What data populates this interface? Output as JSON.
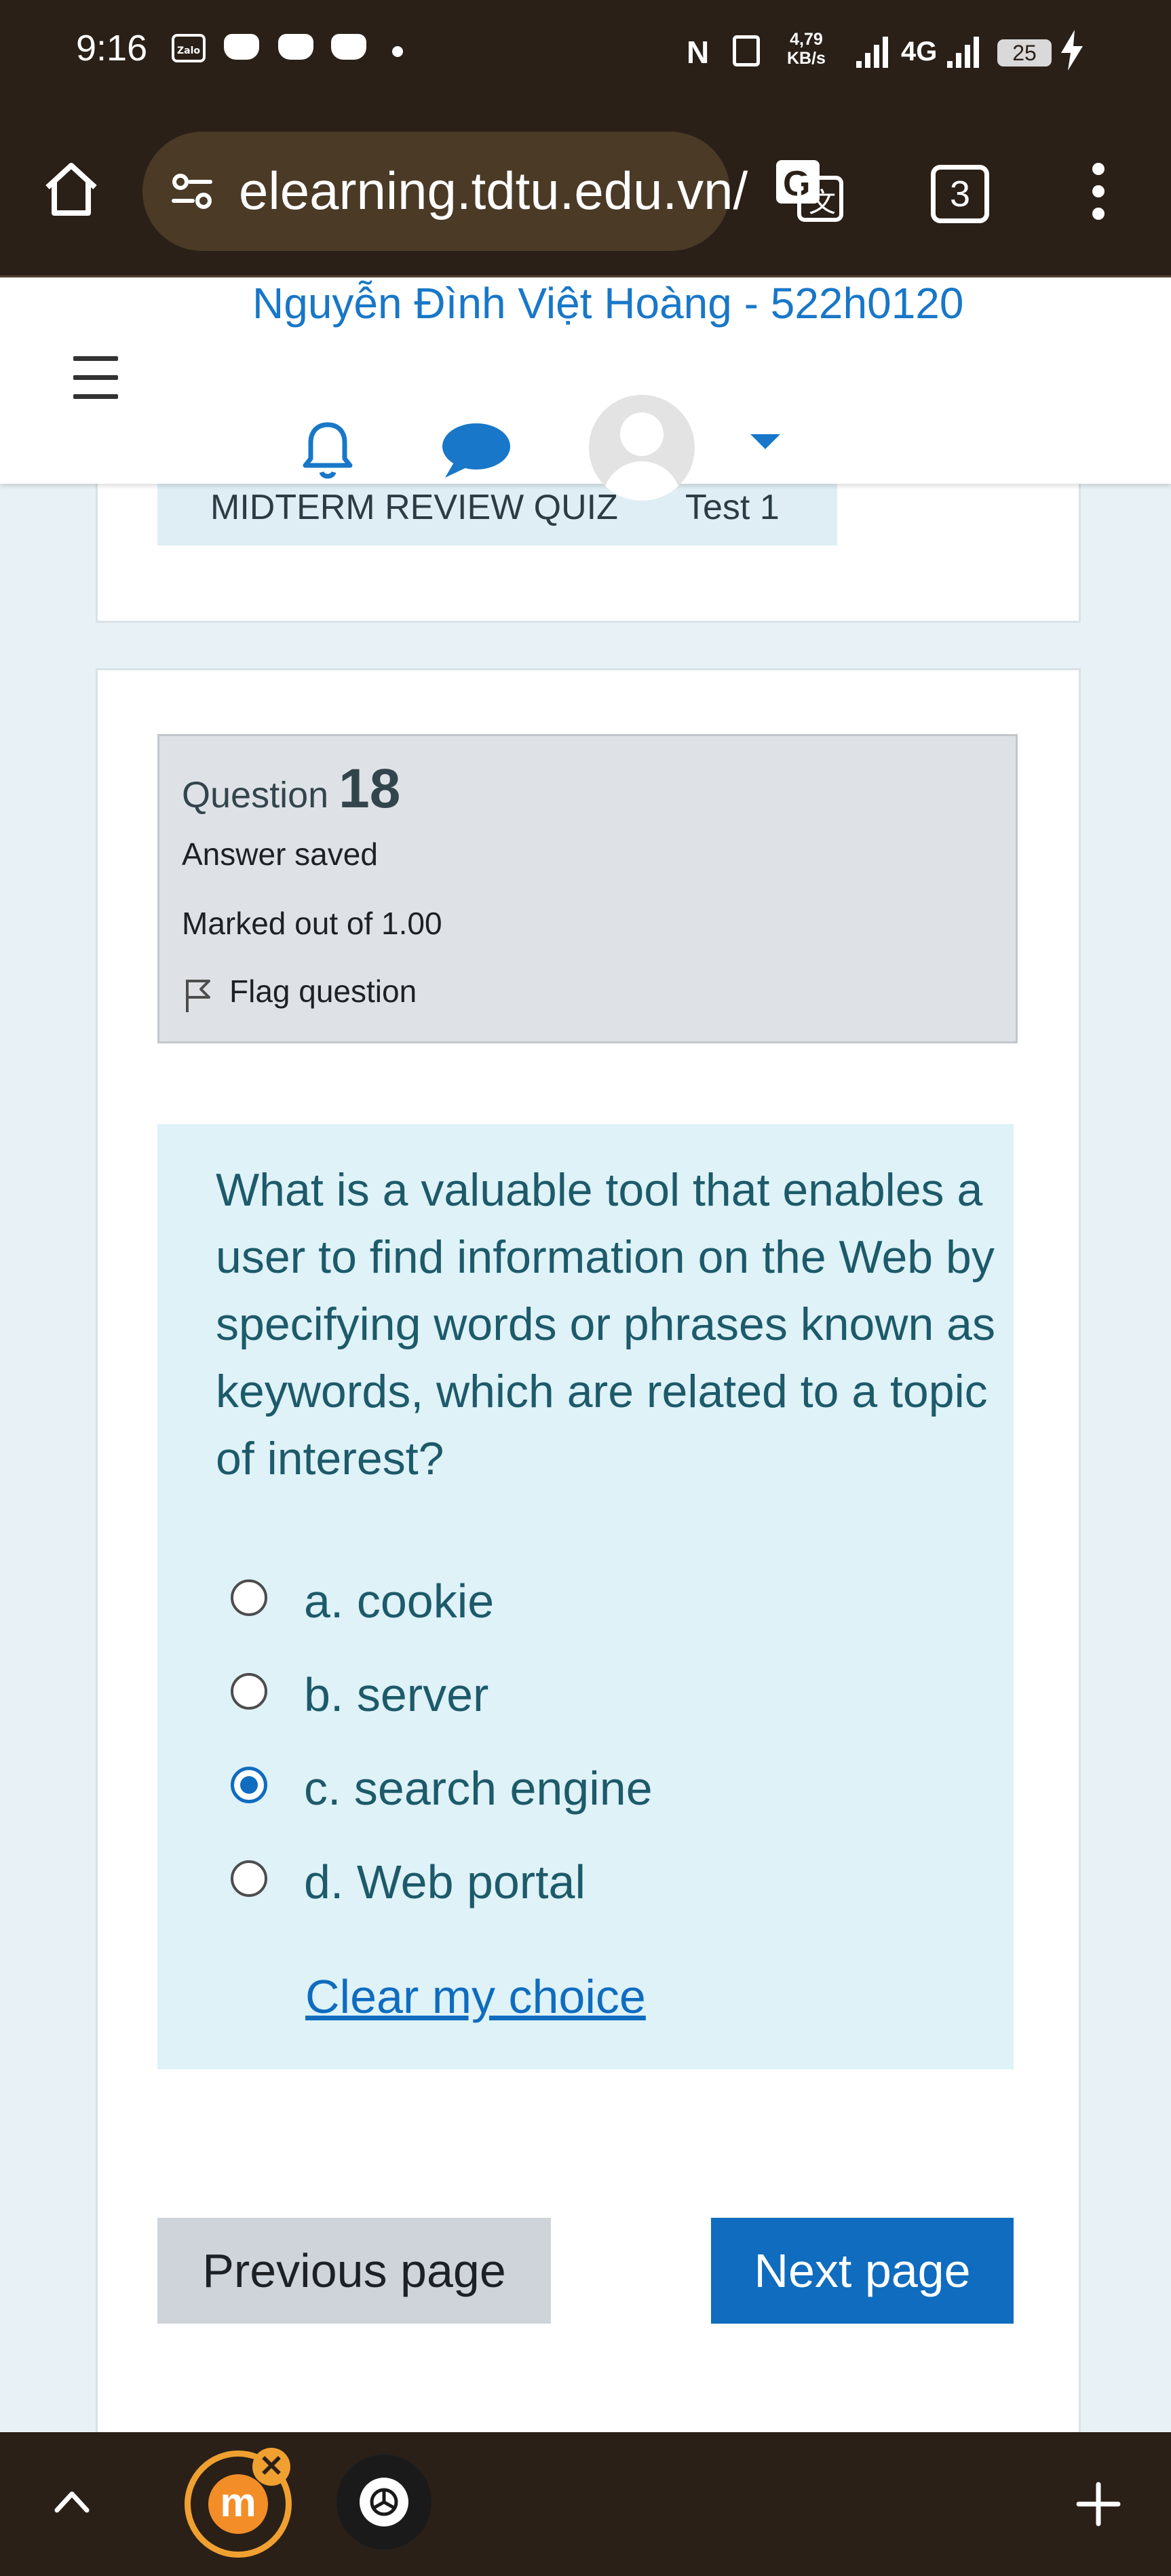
{
  "status_bar": {
    "time": "9:16",
    "app_icon_label": "Zalo",
    "network_speed": "4,79\nKB/s",
    "network_type": "4G",
    "battery": "25"
  },
  "browser": {
    "url": "elearning.tdtu.edu.vn/",
    "tab_count": "3"
  },
  "header": {
    "user_name": "Nguyễn Đình Việt Hoàng - 522h0120"
  },
  "breadcrumb": {
    "items": [
      "MIDTERM REVIEW QUIZ",
      "Test 1"
    ]
  },
  "question": {
    "label": "Question",
    "number": "18",
    "status": "Answer saved",
    "marks": "Marked out of 1.00",
    "flag_label": "Flag question",
    "text": "What is a valuable tool that enables a user to find information on the Web by specifying words or phrases known as keywords, which are related to a topic of interest?",
    "options": [
      {
        "label": "a. cookie",
        "checked": false
      },
      {
        "label": "b. server",
        "checked": false
      },
      {
        "label": "c. search engine",
        "checked": true
      },
      {
        "label": "d. Web portal",
        "checked": false
      }
    ],
    "clear_label": "Clear my choice"
  },
  "navigation": {
    "previous_label": "Previous page",
    "next_label": "Next page"
  },
  "colors": {
    "link_blue": "#0f6cbf",
    "username_blue": "#1877c8",
    "question_bg": "#def2f8",
    "status_bar_bg": "#2a2018"
  }
}
